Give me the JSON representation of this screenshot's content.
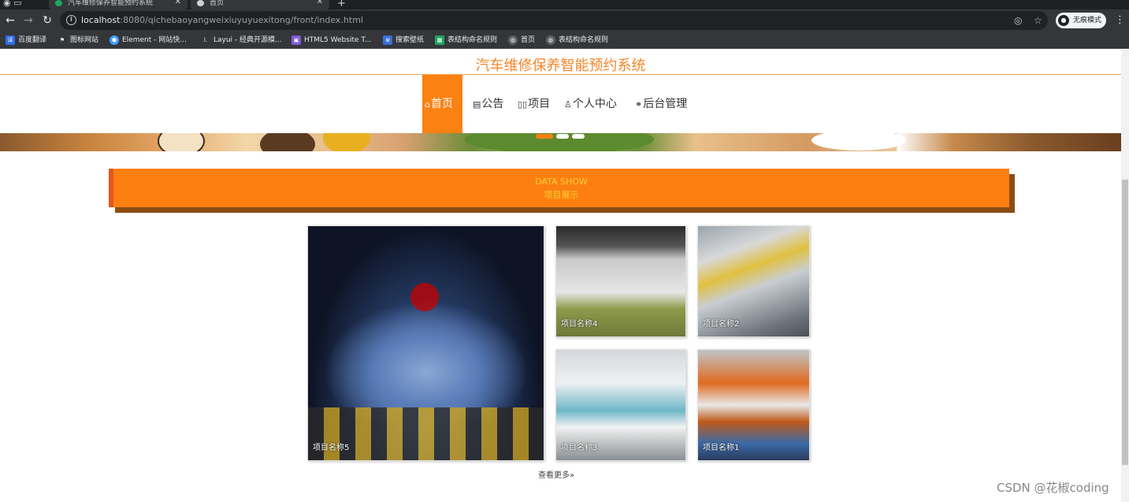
{
  "browser": {
    "tabs": [
      {
        "title": "汽车维修保养智能预约系统"
      },
      {
        "title": "首页"
      }
    ],
    "url_host": "localhost",
    "url_rest": ":8080/qichebaoyangweixiuyuyuexitong/front/index.html",
    "incognito_label": "无痕模式",
    "bookmarks": [
      {
        "label": "百度翻译",
        "color": "#2b6de8"
      },
      {
        "label": "图标网站",
        "color": "#35363a"
      },
      {
        "label": "Element - 网站快...",
        "color": "#409eff"
      },
      {
        "label": "Layui - 经典开源模...",
        "color": "#35363a"
      },
      {
        "label": "HTML5 Website T...",
        "color": "#7b5cd6"
      },
      {
        "label": "搜索壁纸",
        "color": "#3b6fd8"
      },
      {
        "label": "表结构命名规则",
        "color": "#1fa463"
      },
      {
        "label": "首页",
        "color": "#5f6368"
      },
      {
        "label": "表结构命名规则",
        "color": "#5f6368"
      }
    ]
  },
  "site": {
    "title": "汽车维修保养智能预约系统",
    "nav": [
      {
        "label": "首页",
        "icon": "home-icon",
        "glyph": "⌂"
      },
      {
        "label": "公告",
        "icon": "notice-icon",
        "glyph": "▤"
      },
      {
        "label": "项目",
        "icon": "project-icon",
        "glyph": "▯▯"
      },
      {
        "label": "个人中心",
        "icon": "user-icon",
        "glyph": "♙"
      },
      {
        "label": "后台管理",
        "icon": "link-icon",
        "glyph": "⚭"
      }
    ],
    "section": {
      "en": "DATA SHOW",
      "cn": "项目展示"
    },
    "projects": [
      {
        "name": "项目名称5"
      },
      {
        "name": "项目名称4"
      },
      {
        "name": "项目名称2"
      },
      {
        "name": "项目名称3"
      },
      {
        "name": "项目名称1"
      }
    ],
    "more_label": "查看更多"
  },
  "watermark": "CSDN @花椒coding",
  "colors": {
    "accent": "#fa8112",
    "title": "#f5872a",
    "section_text": "#f9d232"
  }
}
